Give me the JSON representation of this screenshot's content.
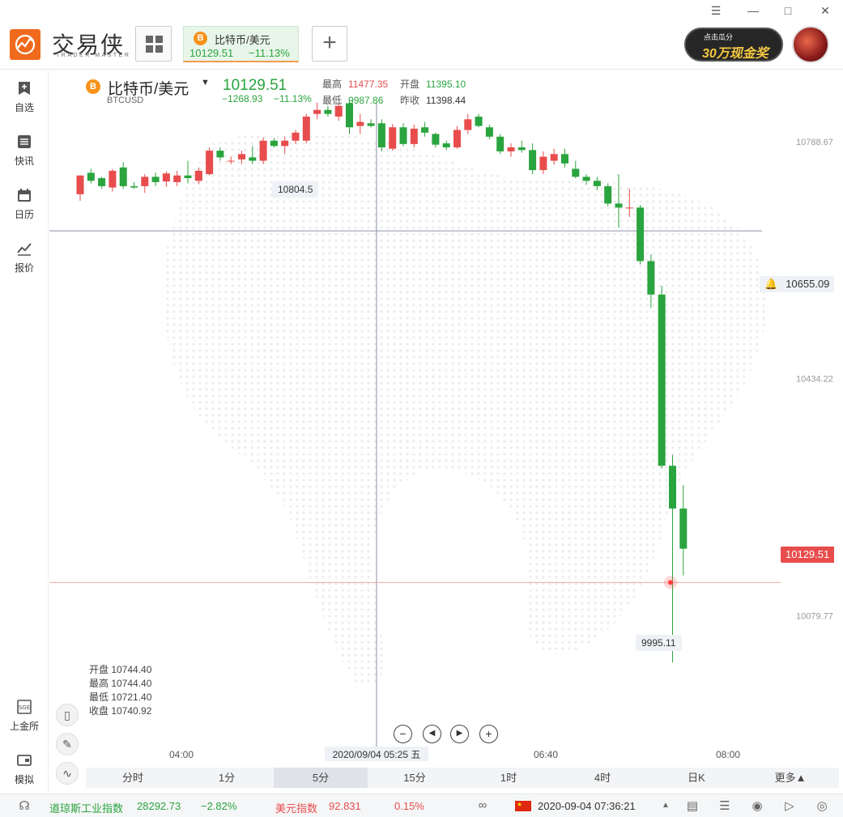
{
  "app": {
    "logo_text": "交易侠",
    "logo_sub": "TRADER MASTER"
  },
  "tab": {
    "name": "比特币/美元",
    "price": "10129.51",
    "change_pct": "−11.13%"
  },
  "promo": {
    "line1": "点击瓜分",
    "line2": "30万现金奖"
  },
  "nav": [
    {
      "label": "自选",
      "icon": "bookmark-icon"
    },
    {
      "label": "快讯",
      "icon": "news-list-icon"
    },
    {
      "label": "日历",
      "icon": "calendar-icon"
    },
    {
      "label": "报价",
      "icon": "quote-chart-icon"
    },
    {
      "label": "上金所",
      "icon": "sge-icon"
    },
    {
      "label": "模拟",
      "icon": "wallet-icon"
    }
  ],
  "header": {
    "name": "比特币/美元",
    "code": "BTCUSD",
    "last": "10129.51",
    "change": "−1268.93",
    "change_pct": "−11.13%",
    "high_label": "最高",
    "high": "11477.35",
    "low_label": "最低",
    "low": "9987.86",
    "open_label": "开盘",
    "open": "11395.10",
    "prev_label": "昨收",
    "prev": "11398.44"
  },
  "ohlc": {
    "open": "开盘 10744.40",
    "high": "最高 10744.40",
    "low": "最低 10721.40",
    "close": "收盘 10740.92"
  },
  "chart_data": {
    "type": "candlestick",
    "y_ticks": [
      10788.67,
      10434.22,
      10079.77
    ],
    "ylim": [
      9975,
      10895
    ],
    "x_ticks": [
      "04:00",
      "06:40",
      "08:00"
    ],
    "crosshair_time": "2020/09/04 05:25 五",
    "alert_price": "10655.09",
    "last_price": "10129.51",
    "max_label": "10804.5",
    "min_label": "9995.11",
    "candles": [
      [
        10710,
        10738,
        10700,
        10738
      ],
      [
        10742,
        10748,
        10726,
        10730
      ],
      [
        10734,
        10736,
        10718,
        10722
      ],
      [
        10720,
        10748,
        10714,
        10745
      ],
      [
        10750,
        10758,
        10718,
        10722
      ],
      [
        10722,
        10728,
        10718,
        10720
      ],
      [
        10722,
        10740,
        10712,
        10736
      ],
      [
        10736,
        10742,
        10722,
        10728
      ],
      [
        10729,
        10744,
        10721,
        10741
      ],
      [
        10728,
        10745,
        10722,
        10738
      ],
      [
        10738,
        10760,
        10726,
        10734
      ],
      [
        10730,
        10750,
        10725,
        10745
      ],
      [
        10740,
        10780,
        10738,
        10775
      ],
      [
        10775,
        10780,
        10760,
        10765
      ],
      [
        10760,
        10766,
        10755,
        10760
      ],
      [
        10762,
        10775,
        10755,
        10770
      ],
      [
        10765,
        10782,
        10755,
        10760
      ],
      [
        10760,
        10795,
        10755,
        10790
      ],
      [
        10790,
        10794,
        10780,
        10782
      ],
      [
        10782,
        10796,
        10770,
        10790
      ],
      [
        10790,
        10806,
        10785,
        10802
      ],
      [
        10790,
        10830,
        10786,
        10826
      ],
      [
        10830,
        10847,
        10822,
        10836
      ],
      [
        10836,
        10842,
        10826,
        10830
      ],
      [
        10826,
        10846,
        10820,
        10842
      ],
      [
        10846,
        10850,
        10800,
        10810
      ],
      [
        10812,
        10830,
        10800,
        10818
      ],
      [
        10816,
        10822,
        10810,
        10812
      ],
      [
        10816,
        10822,
        10774,
        10780
      ],
      [
        10778,
        10815,
        10775,
        10810
      ],
      [
        10810,
        10816,
        10782,
        10785
      ],
      [
        10785,
        10814,
        10780,
        10808
      ],
      [
        10810,
        10818,
        10796,
        10802
      ],
      [
        10800,
        10802,
        10780,
        10784
      ],
      [
        10786,
        10790,
        10776,
        10780
      ],
      [
        10780,
        10812,
        10778,
        10806
      ],
      [
        10806,
        10830,
        10800,
        10822
      ],
      [
        10826,
        10830,
        10810,
        10812
      ],
      [
        10810,
        10814,
        10792,
        10796
      ],
      [
        10796,
        10800,
        10770,
        10774
      ],
      [
        10774,
        10786,
        10766,
        10780
      ],
      [
        10780,
        10790,
        10772,
        10776
      ],
      [
        10776,
        10786,
        10740,
        10746
      ],
      [
        10746,
        10774,
        10740,
        10766
      ],
      [
        10760,
        10778,
        10754,
        10770
      ],
      [
        10770,
        10778,
        10750,
        10756
      ],
      [
        10748,
        10760,
        10734,
        10736
      ],
      [
        10736,
        10740,
        10724,
        10730
      ],
      [
        10730,
        10736,
        10716,
        10722
      ],
      [
        10722,
        10726,
        10692,
        10696
      ],
      [
        10696,
        10740,
        10660,
        10690
      ],
      [
        10690,
        10718,
        10676,
        10690
      ],
      [
        10690,
        10694,
        10605,
        10610
      ],
      [
        10610,
        10620,
        10540,
        10560
      ],
      [
        10560,
        10573,
        10300,
        10304
      ],
      [
        10304,
        10320,
        10010,
        10240
      ],
      [
        10240,
        10275,
        10140,
        10180
      ]
    ]
  },
  "timeframes": [
    "分时",
    "1分",
    "5分",
    "15分",
    "1时",
    "4时",
    "日K",
    "更多▲"
  ],
  "active_timeframe": 2,
  "status": {
    "dow_name": "道琼斯工业指数",
    "dow_value": "28292.73",
    "dow_change": "−2.82%",
    "usd_name": "美元指数",
    "usd_value": "92.831",
    "usd_change": "0.15%",
    "datetime": "2020-09-04 07:36:21"
  },
  "colors": {
    "up": "#e84c4c",
    "down": "#2aa43e",
    "accent": "#f06a1c"
  }
}
